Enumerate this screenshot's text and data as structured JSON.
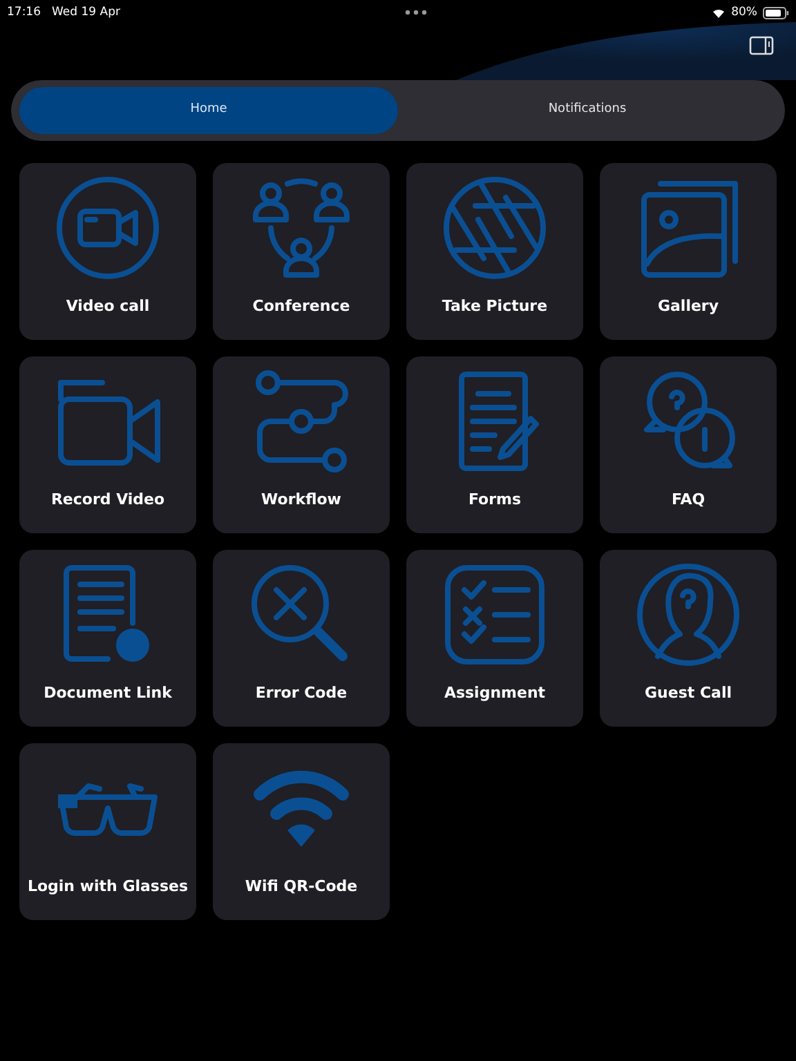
{
  "status_bar": {
    "time": "17:16",
    "date": "Wed 19 Apr",
    "battery": "80%"
  },
  "tabs": [
    {
      "label": "Home",
      "selected": true
    },
    {
      "label": "Notifications",
      "selected": false
    }
  ],
  "tiles": [
    {
      "kind": "videocall",
      "label": "Video call"
    },
    {
      "kind": "conference",
      "label": "Conference"
    },
    {
      "kind": "camera",
      "label": "Take Picture"
    },
    {
      "kind": "gallery",
      "label": "Gallery"
    },
    {
      "kind": "record",
      "label": "Record Video"
    },
    {
      "kind": "workflow",
      "label": "Workflow"
    },
    {
      "kind": "forms",
      "label": "Forms"
    },
    {
      "kind": "faq",
      "label": "FAQ"
    },
    {
      "kind": "doclink",
      "label": "Document Link"
    },
    {
      "kind": "error",
      "label": "Error Code"
    },
    {
      "kind": "assignment",
      "label": "Assignment"
    },
    {
      "kind": "guest",
      "label": "Guest Call"
    },
    {
      "kind": "glasses",
      "label": "Login with Glasses"
    },
    {
      "kind": "wifi",
      "label": "Wifi QR-Code"
    }
  ]
}
